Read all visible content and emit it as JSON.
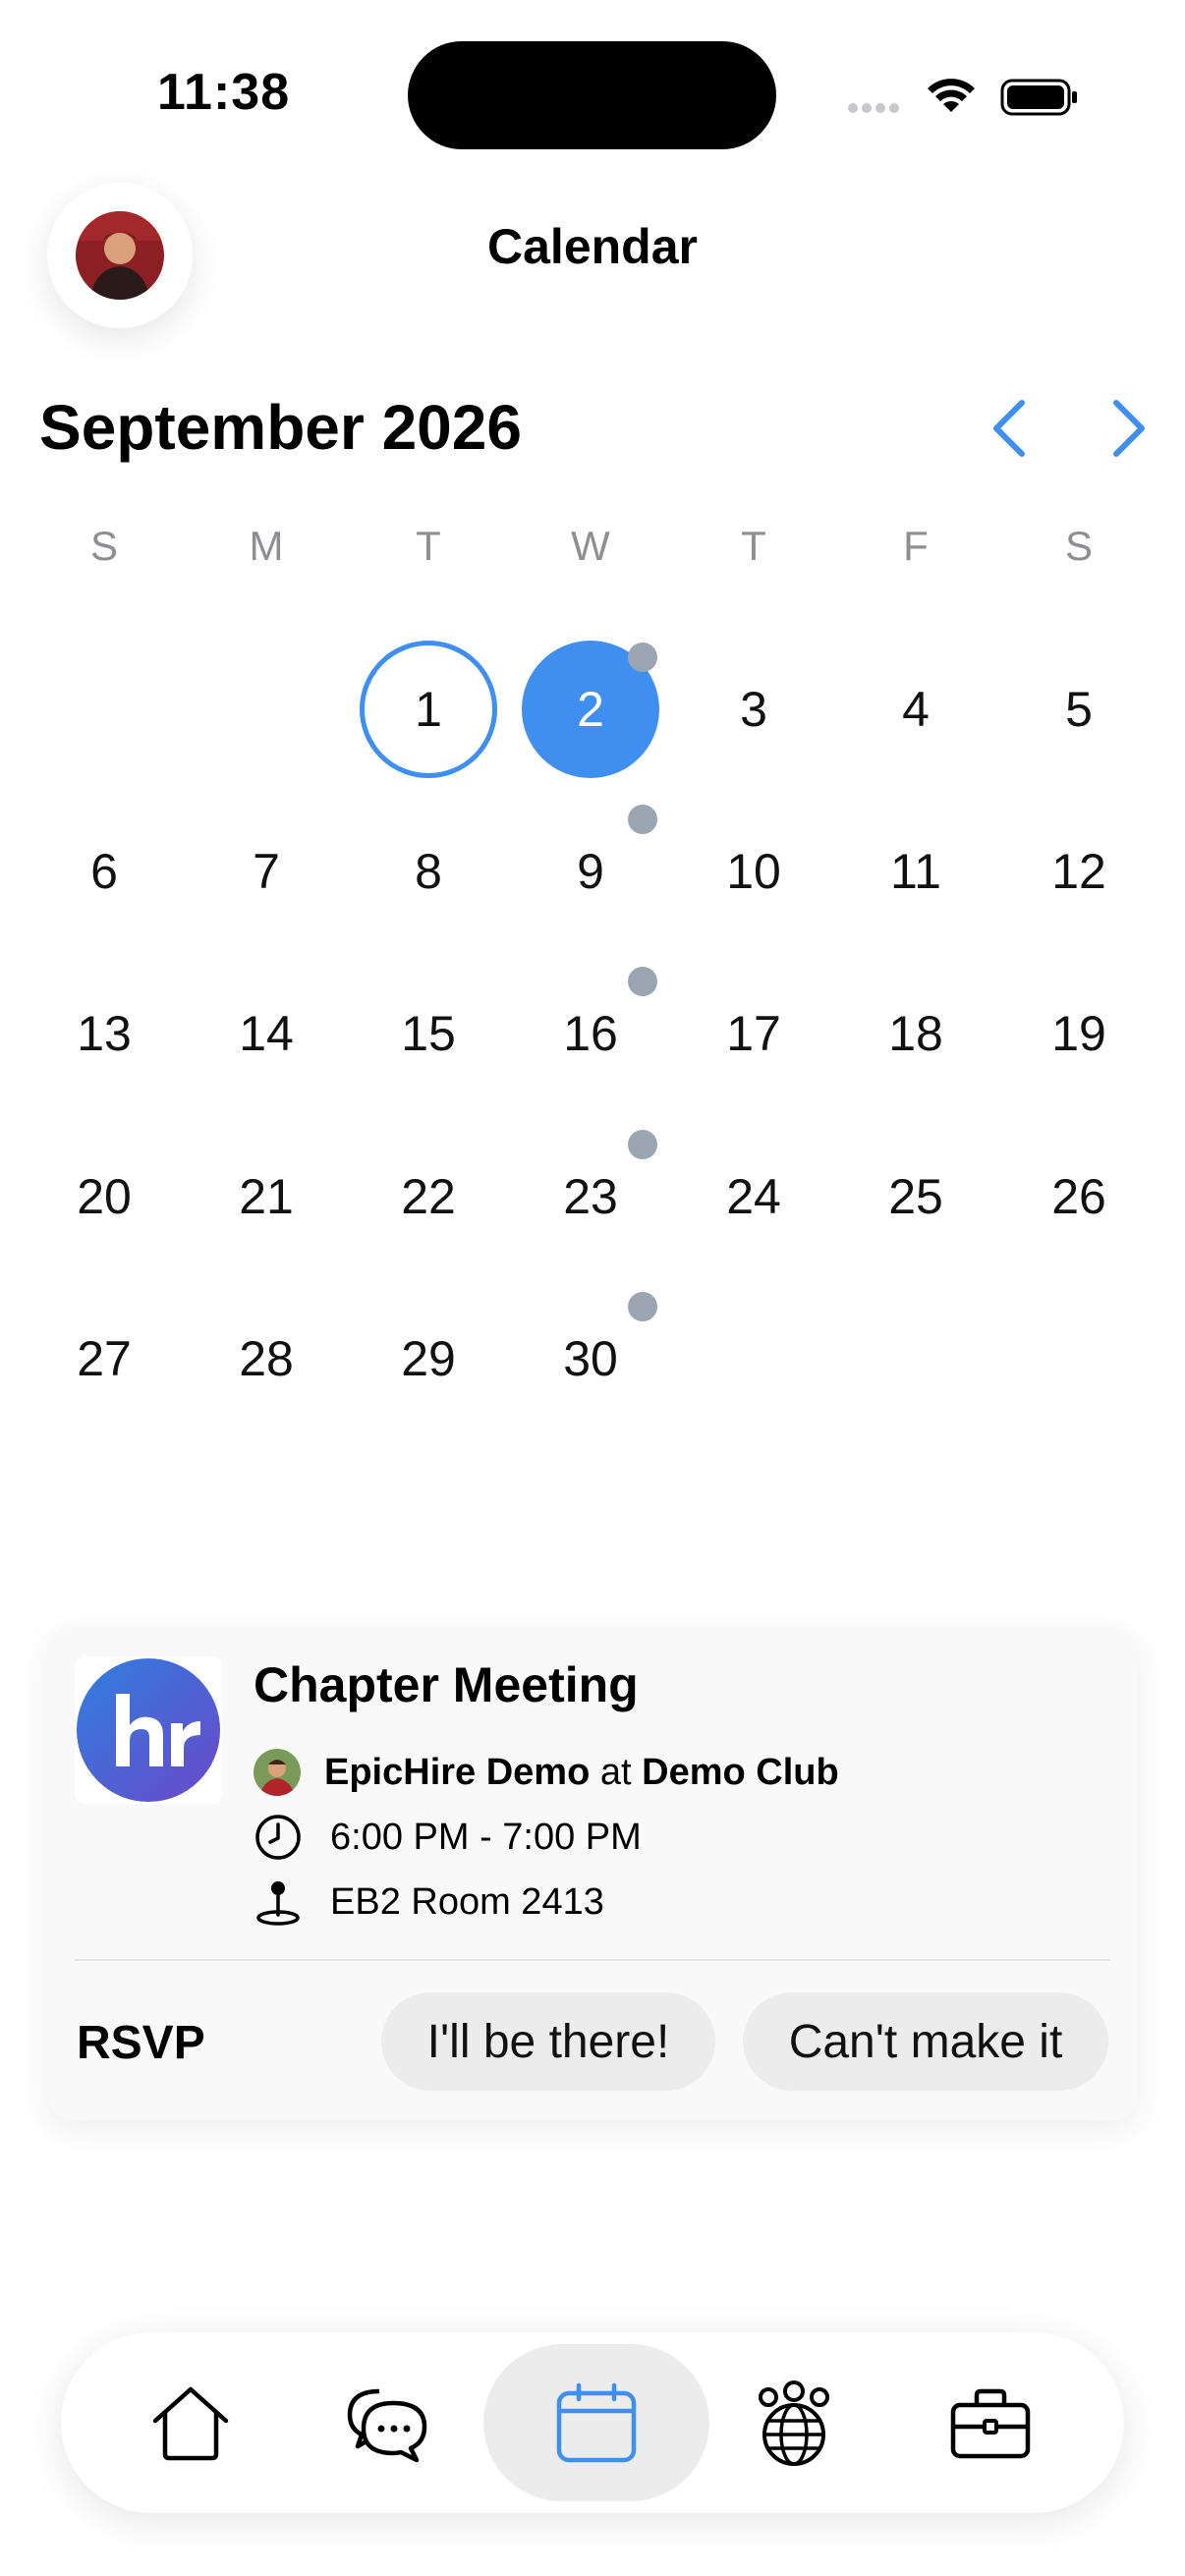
{
  "status_bar": {
    "time": "11:38"
  },
  "header": {
    "title": "Calendar",
    "avatar_icon": "user-avatar"
  },
  "calendar": {
    "month_label": "September 2026",
    "prev_icon": "chevron-left-icon",
    "next_icon": "chevron-right-icon",
    "accent_color": "#3f8ff0",
    "event_dot_color": "#9aa5b1",
    "weekdays": [
      "S",
      "M",
      "T",
      "W",
      "T",
      "F",
      "S"
    ],
    "days": [
      "1",
      "2",
      "3",
      "4",
      "5",
      "6",
      "7",
      "8",
      "9",
      "10",
      "11",
      "12",
      "13",
      "14",
      "15",
      "16",
      "17",
      "18",
      "19",
      "20",
      "21",
      "22",
      "23",
      "24",
      "25",
      "26",
      "27",
      "28",
      "29",
      "30"
    ],
    "today": "1",
    "selected": "2",
    "event_days": [
      "2",
      "9",
      "16",
      "23",
      "30"
    ]
  },
  "event": {
    "title": "Chapter Meeting",
    "organizer": "EpicHire Demo",
    "at": "at",
    "club": "Demo Club",
    "time": "6:00 PM - 7:00 PM",
    "location": "EB2 Room 2413",
    "rsvp_label": "RSVP",
    "rsvp_yes": "I'll be there!",
    "rsvp_no": "Can't make it"
  },
  "tab_bar": {
    "tabs": [
      {
        "name": "home",
        "icon": "house-icon",
        "active": false
      },
      {
        "name": "messages",
        "icon": "chat-bubbles-icon",
        "active": false
      },
      {
        "name": "calendar",
        "icon": "calendar-icon",
        "active": true
      },
      {
        "name": "community",
        "icon": "globe-people-icon",
        "active": false
      },
      {
        "name": "jobs",
        "icon": "briefcase-icon",
        "active": false
      }
    ]
  }
}
